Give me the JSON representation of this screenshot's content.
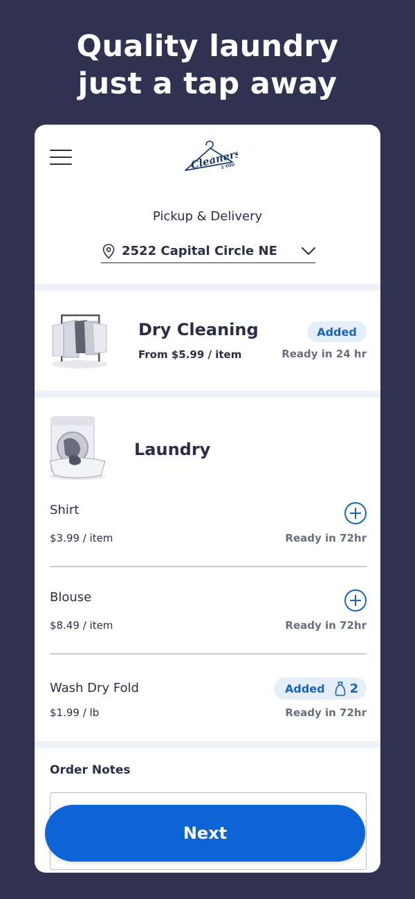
{
  "headline": {
    "line1": "Quality laundry",
    "line2": "just a tap away"
  },
  "header": {
    "logo_icon": "cleaners-2-you-logo",
    "menu_icon": "hamburger-menu-icon"
  },
  "location": {
    "title": "Pickup & Delivery",
    "address": "2522 Capital Circle NE",
    "pin_icon": "location-pin-icon",
    "dropdown_icon": "chevron-down-icon"
  },
  "dry_cleaning": {
    "title": "Dry Cleaning",
    "price": "From $5.99 / item",
    "badge": "Added",
    "ready": "Ready in 24 hr"
  },
  "laundry": {
    "title": "Laundry",
    "items": [
      {
        "name": "Shirt",
        "price": "$3.99 / item",
        "ready": "Ready in 72hr"
      },
      {
        "name": "Blouse",
        "price": "$8.49 / item",
        "ready": "Ready in 72hr"
      },
      {
        "name": "Wash Dry Fold",
        "price": "$1.99 / lb",
        "ready": "Ready in 72hr",
        "badge": "Added",
        "bag_count": "2"
      }
    ]
  },
  "order_notes": {
    "label": "Order Notes"
  },
  "footer": {
    "next_label": "Next"
  },
  "colors": {
    "background": "#2f3350",
    "accent": "#0d64d6",
    "badge_bg": "#e5eefb",
    "badge_text": "#1565c0"
  }
}
